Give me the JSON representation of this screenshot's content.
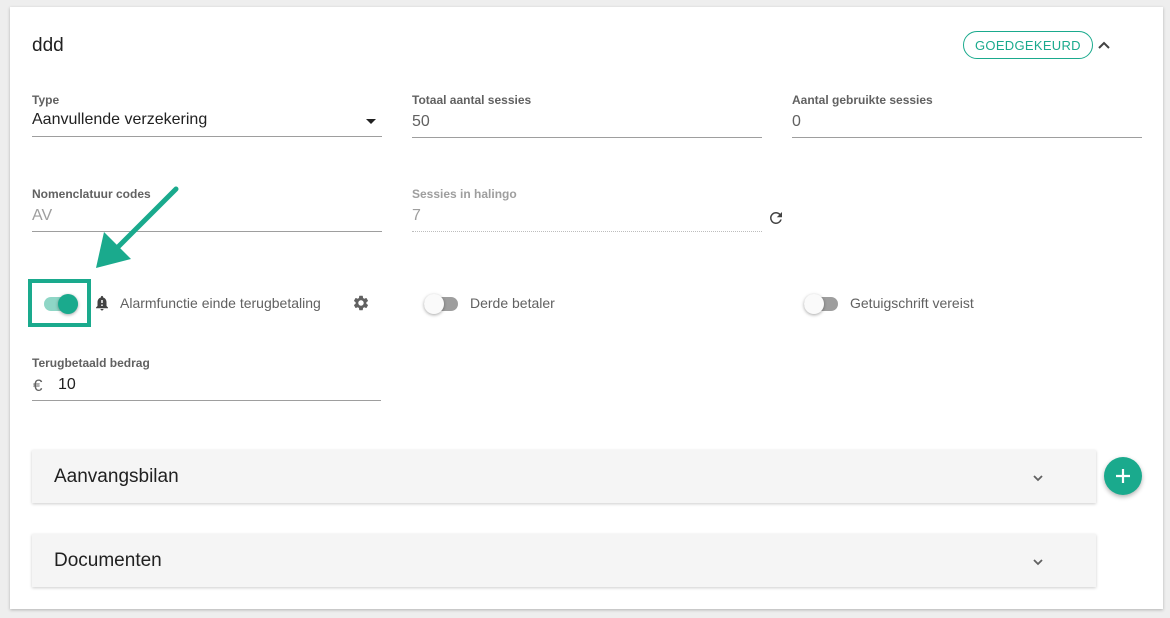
{
  "header": {
    "title": "ddd",
    "status": "GOEDGEKEURD"
  },
  "fields": {
    "type": {
      "label": "Type",
      "value": "Aanvullende verzekering"
    },
    "total_sessions": {
      "label": "Totaal aantal sessies",
      "value": "50"
    },
    "used_sessions": {
      "label": "Aantal gebruikte sessies",
      "value": "0"
    },
    "nomenclature": {
      "label": "Nomenclatuur codes",
      "value": "AV"
    },
    "halingo_sessions": {
      "label": "Sessies in halingo",
      "value": "7"
    },
    "refunded_amount": {
      "label": "Terugbetaald bedrag",
      "currency": "€",
      "value": "10"
    }
  },
  "toggles": {
    "alarm": {
      "label": "Alarmfunctie einde terugbetaling",
      "on": true
    },
    "third_party": {
      "label": "Derde betaler",
      "on": false
    },
    "certificate": {
      "label": "Getuigschrift vereist",
      "on": false
    }
  },
  "panels": [
    {
      "title": "Aanvangsbilan"
    },
    {
      "title": "Documenten"
    }
  ],
  "colors": {
    "accent": "#1aaa8d",
    "toggle_on_track": "#8fd6c6",
    "toggle_off_track": "#9e9e9e"
  }
}
